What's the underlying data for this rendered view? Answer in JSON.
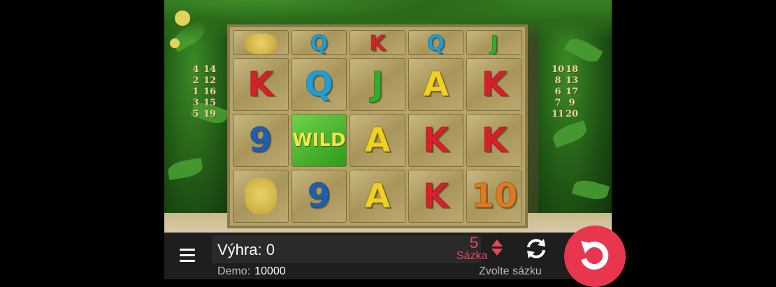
{
  "reels": {
    "top_row": [
      "mask",
      "Q",
      "K",
      "Q",
      "J"
    ],
    "rows": [
      [
        "K",
        "Q",
        "J",
        "A",
        "K"
      ],
      [
        "9",
        "WILD",
        "A",
        "K",
        "K"
      ],
      [
        "mask",
        "9",
        "A",
        "K",
        "10"
      ]
    ]
  },
  "symbol_colors": {
    "K": "#d8202a",
    "Q": "#1aa0df",
    "J": "#2fb02a",
    "A": "#f0d020",
    "9": "#1c5fb5",
    "10": "#e07a20",
    "WILD": "#f4e24a"
  },
  "paylines": {
    "left": [
      "4",
      "14",
      "2",
      "12",
      "1",
      "16",
      "3",
      "15",
      "5",
      "19"
    ],
    "right": [
      "10",
      "18",
      "8",
      "13",
      "6",
      "17",
      "7",
      "9",
      "11",
      "20"
    ]
  },
  "bottom_bar": {
    "win_label": "Výhra: 0",
    "demo_label": "Demo:",
    "demo_value": "10000",
    "bet_value": "5",
    "bet_label": "Sázka",
    "choose_bet": "Zvolte sázku"
  },
  "colors": {
    "accent": "#e8364f",
    "bar_bg": "#1e1e1e"
  },
  "icons": [
    "hamburger-menu-icon",
    "bet-up-arrow-icon",
    "bet-down-arrow-icon",
    "autoplay-icon",
    "spin-icon"
  ]
}
